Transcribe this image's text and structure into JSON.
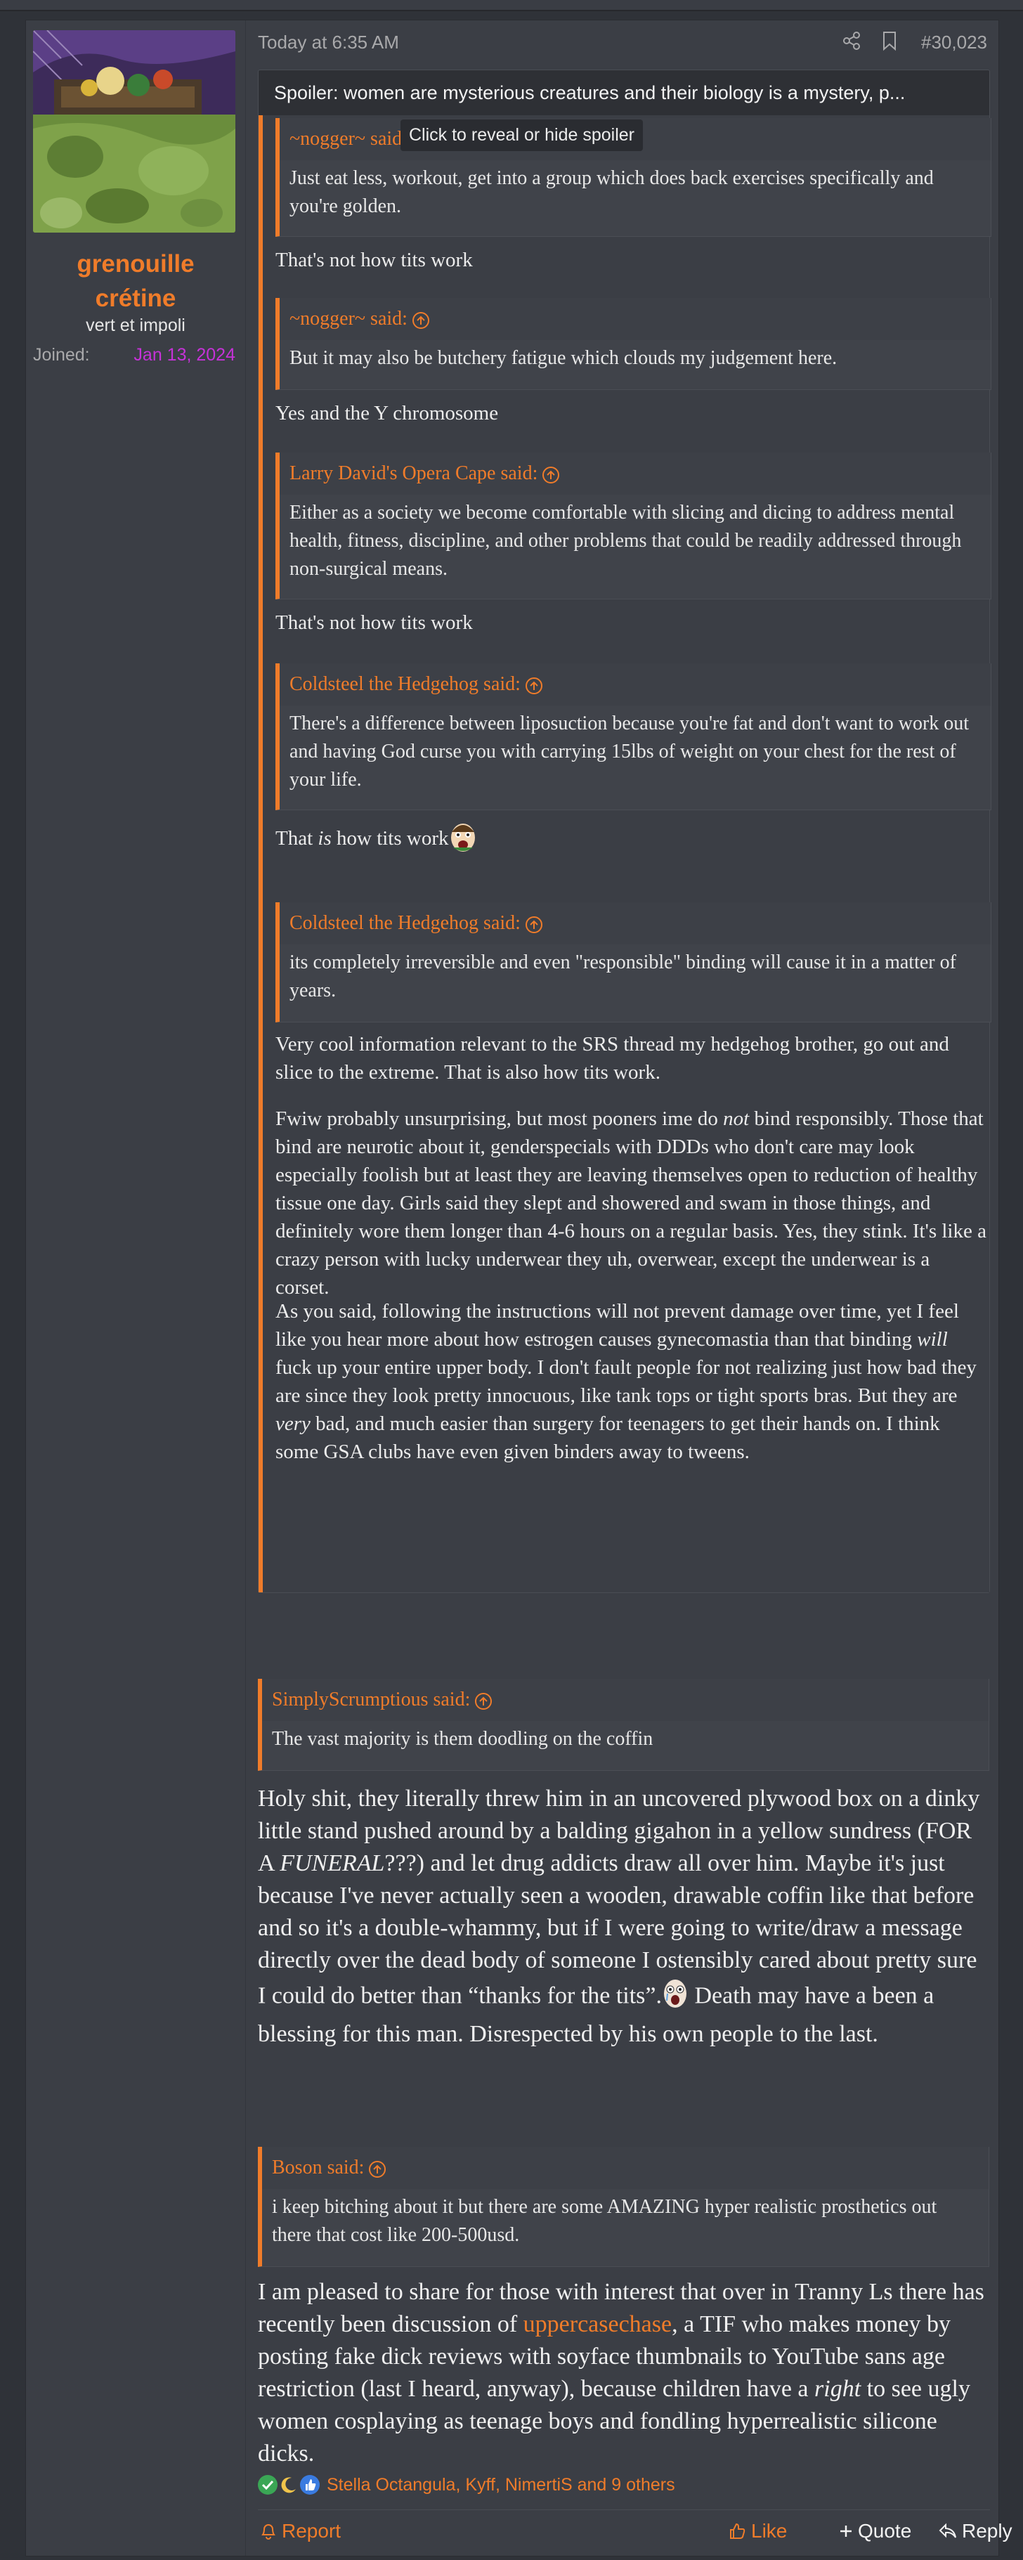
{
  "post": {
    "date": "Today at 6:35 AM",
    "number": "#30,023"
  },
  "user": {
    "name_line1": "grenouille",
    "name_line2": "crétine",
    "title": "vert et impoli",
    "joined_label": "Joined:",
    "joined_value": "Jan 13, 2024"
  },
  "spoiler": {
    "title": "Spoiler: women are mysterious creatures and their biology is a mystery, p...",
    "tooltip": "Click to reveal or hide spoiler",
    "q1_author": "~nogger~ said:",
    "q1_text": "Just eat less, workout, get into a group which does back exercises specifically and you're golden.",
    "r1": "That's not how tits work",
    "q2_author": "~nogger~ said:",
    "q2_text": "But it may also be butchery fatigue which clouds my judgement here.",
    "r2": "Yes and the Y chromosome",
    "q3_author": "Larry David's Opera Cape said:",
    "q3_text": "Either as a society we become comfortable with slicing and dicing to address mental health, fitness, discipline, and other problems that could be readily addressed through non-surgical means.",
    "r3": "That's not how tits work",
    "q4_author": "Coldsteel the Hedgehog said:",
    "q4_text": "There's a difference between liposuction because you're fat and don't want to work out and having God curse you with carrying 15lbs of weight on your chest for the rest of your life.",
    "r4_a": "That ",
    "r4_b": "is",
    "r4_c": " how tits work",
    "q5_author": "Coldsteel the Hedgehog said:",
    "q5_text": "its completely irreversible and even \"responsible\" binding will cause it in a matter of years.",
    "r5": "Very cool information relevant to the SRS thread my hedgehog brother, go out and slice to the extreme. That is also how tits work.",
    "p6_a": "Fwiw probably unsurprising, but most pooners ime do ",
    "p6_b": "not",
    "p6_c": " bind responsibly. Those that bind are neurotic about it, genderspecials with DDDs who don't care may look especially foolish but at least they are leaving themselves open to reduction of healthy tissue one day. Girls said they slept and showered and swam in those things, and definitely wore them longer than 4-6 hours on a regular basis. Yes, they stink. It's like a crazy person with lucky underwear they uh, overwear, except the underwear is a corset.",
    "p7_a": "As you said, following the instructions will not prevent damage over time, yet I feel like you hear more about how estrogen causes gynecomastia than that binding ",
    "p7_b": "will",
    "p7_c": " fuck up your entire upper body. I don't fault people for not realizing just how bad they are since they look pretty innocuous, like tank tops or tight sports bras. But they are ",
    "p7_d": "very",
    "p7_e": " bad, and much easier than surgery for teenagers to get their hands on. I think some GSA clubs have even given binders away to tweens."
  },
  "quote_ss": {
    "author": "SimplyScrumptious said:",
    "text": "The vast majority is them doodling on the coffin"
  },
  "body1": {
    "a": "Holy shit, they literally threw him in an uncovered plywood box on a dinky little stand pushed around by a balding gigahon in a yellow sundress (FOR A ",
    "b": "FUNERAL",
    "c": "???) and let drug addicts draw all over him. Maybe it's just because I've never actually seen a wooden, drawable coffin like that before and so it's a double-whammy, but if I were going to write/draw a message directly over the dead body of someone I ostensibly cared about pretty sure I could do better than “thanks for the tits”.",
    "d": " Death may have a been a blessing for this man. Disrespected by his own people to the last."
  },
  "quote_boson": {
    "author": "Boson said:",
    "text": "i keep bitching about it but there are some AMAZING hyper realistic prosthetics out there that cost like 200-500usd."
  },
  "body2": {
    "a": "I am pleased to share for those with interest that over in Tranny Ls there has recently been discussion of ",
    "link": "uppercasechase",
    "b": ", a TIF who makes money by posting fake dick reviews with soyface thumbnails to YouTube sans age restriction (last I heard, anyway), because children have a ",
    "c": "right",
    "d": " to see ugly women cosplaying as teenage boys and fondling hyperrealistic silicone dicks."
  },
  "reactions": {
    "names": "Stella Octangula, Kyff, NimertiS and 9 others",
    "icons": [
      "check-icon",
      "moon-icon",
      "thumbs-up-icon"
    ]
  },
  "actions": {
    "report": "Report",
    "like": "Like",
    "quote": "Quote",
    "reply": "Reply"
  },
  "colors": {
    "accent": "#f07c2a",
    "background": "#3b3e45",
    "joined_date": "#c632d8"
  }
}
